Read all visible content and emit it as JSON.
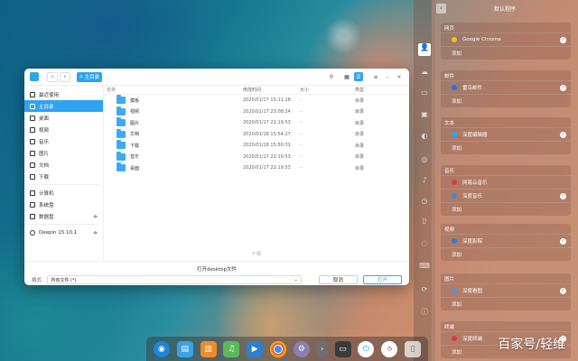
{
  "dialog": {
    "breadcrumb": "主目录",
    "sidebar": [
      {
        "label": "最近使用",
        "selected": false
      },
      {
        "label": "主目录",
        "selected": true
      },
      {
        "label": "桌面",
        "selected": false
      },
      {
        "label": "视频",
        "selected": false
      },
      {
        "label": "音乐",
        "selected": false
      },
      {
        "label": "图片",
        "selected": false
      },
      {
        "label": "文档",
        "selected": false
      },
      {
        "label": "下载",
        "selected": false
      },
      {
        "label": "计算机",
        "selected": false
      },
      {
        "label": "系统盘",
        "selected": false
      },
      {
        "label": "数据盘",
        "selected": false
      },
      {
        "label": "Deepin 15.10.1",
        "selected": false
      }
    ],
    "columns": {
      "name": "名称",
      "time": "修改时间",
      "size": "大小",
      "type": "类型"
    },
    "rows": [
      {
        "name": "模板",
        "time": "2020/01/17 15:11:28",
        "size": "-",
        "type": "目录"
      },
      {
        "name": "视频",
        "time": "2020/01/17 23:08:24",
        "size": "-",
        "type": "目录"
      },
      {
        "name": "图片",
        "time": "2020/01/17 22:19:53",
        "size": "-",
        "type": "目录"
      },
      {
        "name": "文档",
        "time": "2020/01/18 15:54:27",
        "size": "-",
        "type": "目录"
      },
      {
        "name": "下载",
        "time": "2020/01/18 15:50:31",
        "size": "-",
        "type": "目录"
      },
      {
        "name": "音乐",
        "time": "2020/01/17 22:19:53",
        "size": "-",
        "type": "目录"
      },
      {
        "name": "桌面",
        "time": "2020/01/17 22:19:53",
        "size": "-",
        "type": "目录"
      }
    ],
    "item_count": "7 项",
    "footer_title": "打开desktop文件",
    "filter_label": "格式",
    "filter_value": "所有文件 (*)",
    "cancel_label": "取消",
    "open_label": "打开"
  },
  "panel": {
    "title": "默认程序",
    "categories": [
      {
        "title": "网页",
        "apps": [
          "Google Chrome"
        ],
        "add": "添加"
      },
      {
        "title": "邮件",
        "apps": [
          "雷鸟邮件"
        ],
        "add": "添加"
      },
      {
        "title": "文本",
        "apps": [
          "深度编辑器"
        ],
        "add": "添加"
      },
      {
        "title": "音乐",
        "apps": [
          "网易云音乐",
          "深度音乐"
        ],
        "add": "添加"
      },
      {
        "title": "视频",
        "apps": [
          "深度影院"
        ],
        "add": "添加"
      },
      {
        "title": "图片",
        "apps": [
          "深度看图"
        ],
        "add": "添加"
      },
      {
        "title": "终端",
        "apps": [
          "深度终端"
        ],
        "add": "添加"
      }
    ]
  },
  "watermark": "百家号/轻维",
  "colors": {
    "accent": "#2ea3f2"
  }
}
